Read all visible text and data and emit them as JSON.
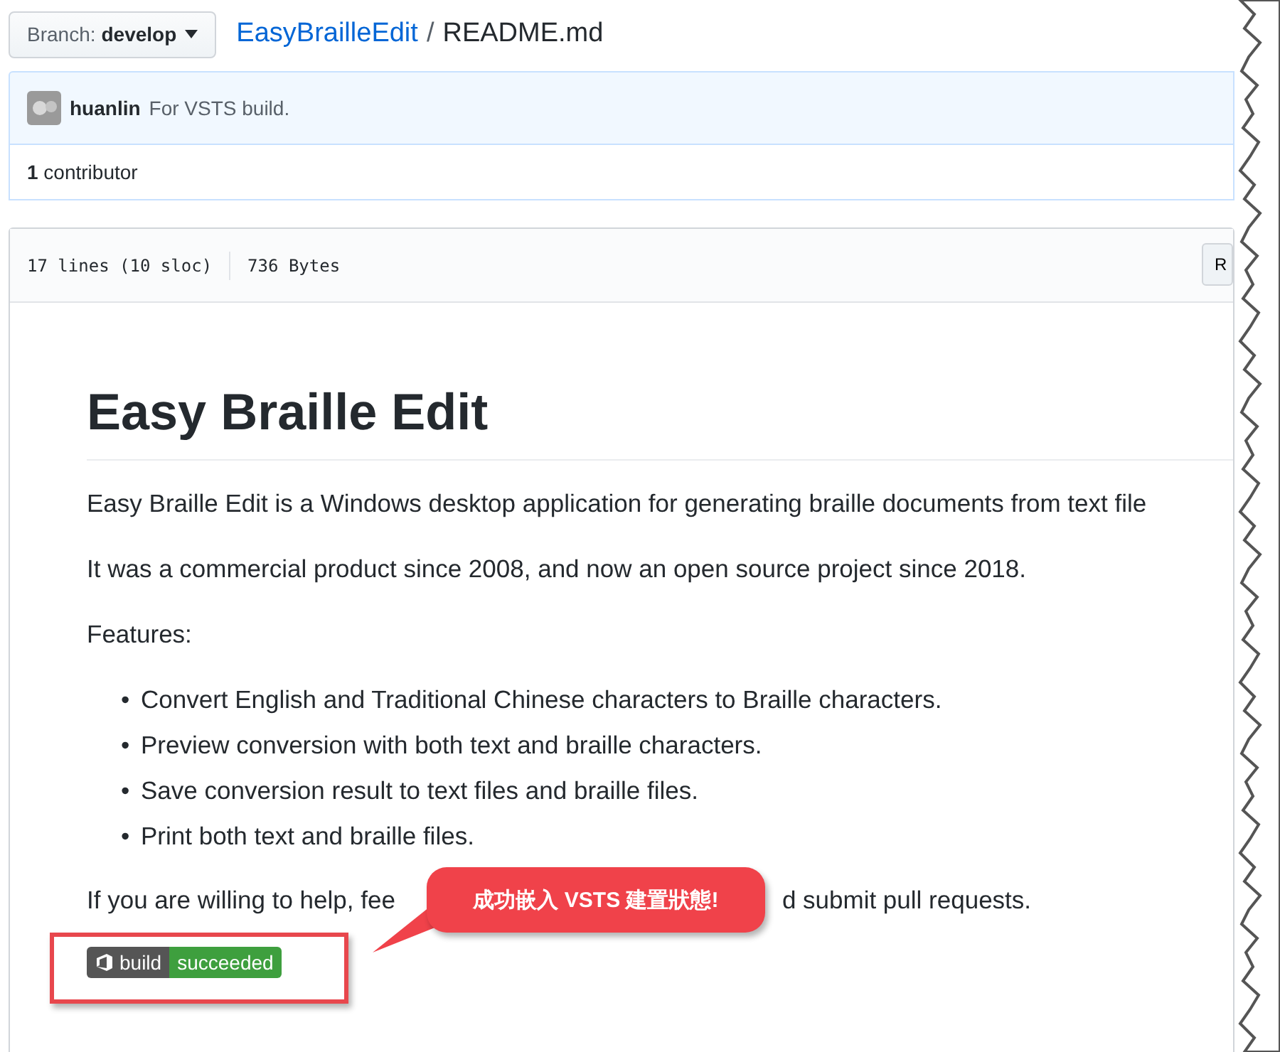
{
  "branch_button": {
    "label": "Branch:",
    "value": "develop"
  },
  "breadcrumb": {
    "repo": "EasyBrailleEdit",
    "separator": "/",
    "file": "README.md"
  },
  "commit": {
    "author": "huanlin",
    "message": "For VSTS build."
  },
  "contributors": "**1** contributor",
  "file_header": {
    "lines": "17 lines (10 sloc)",
    "size": "736 Bytes",
    "button": "R"
  },
  "readme": {
    "title": "Easy Braille Edit",
    "paragraphs": [
      "Easy Braille Edit is a Windows desktop application for generating braille documents from text file",
      "It was a commercial product since 2008, and now an open source project since 2018.",
      "Features:"
    ],
    "features": [
      {
        "marker": "•",
        "text": "Convert English and Traditional Chinese characters to Braille characters."
      },
      {
        "marker": "•",
        "text": "Preview conversion with both text and braille characters."
      },
      {
        "marker": "•",
        "text": "Save conversion result to text files and braille files."
      },
      {
        "marker": "•",
        "text": "Print both text and braille files."
      }
    ],
    "help_text_start": "If you are willing to help, fee",
    "help_text_end": "d submit pull requests.",
    "badge": {
      "label": "build",
      "status": "succeeded"
    }
  },
  "annotation": {
    "callout": "成功嵌入 VSTS 建置狀態!"
  }
}
